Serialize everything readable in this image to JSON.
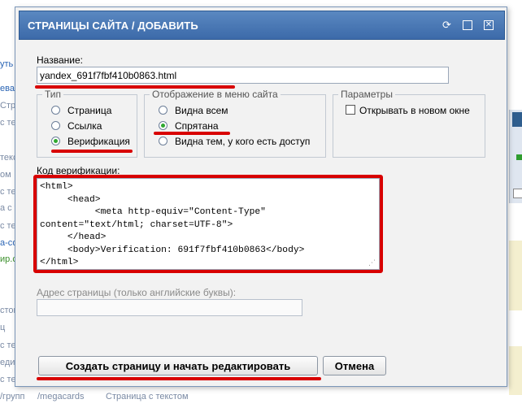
{
  "background": {
    "links": [
      "уть в",
      "ева з",
      "Стра",
      "с текст",
      "текст",
      "ом",
      "с текст",
      "а с тек",
      "с текст",
      "а-соп",
      "ир.со",
      "стом",
      "с текст",
      "ц",
      "едир",
      "с текст"
    ],
    "bottom_path": "/megacards",
    "bottom_text": "Страница с текстом",
    "bottom_left": "/групп"
  },
  "dialog": {
    "title": "СТРАНИЦЫ САЙТА / ДОБАВИТЬ",
    "title_icons": [
      "refresh-icon",
      "maximize-icon",
      "close-icon"
    ],
    "close_glyph": "✕",
    "name_label": "Название:",
    "name_value": "yandex_691f7fbf410b0863.html",
    "type": {
      "legend": "Тип",
      "options": [
        "Страница",
        "Ссылка",
        "Верификация"
      ],
      "selected": "Верификация"
    },
    "menu_display": {
      "legend": "Отображение в меню сайта",
      "options": [
        "Видна всем",
        "Спрятана",
        "Видна тем, у кого есть доступ"
      ],
      "selected": "Спрятана"
    },
    "params": {
      "legend": "Параметры",
      "open_new_window_label": "Открывать в новом окне",
      "open_new_window_checked": false
    },
    "code_label": "Код верификации:",
    "code_value": "<html>\n     <head>\n          <meta http-equiv=\"Content-Type\"\ncontent=\"text/html; charset=UTF-8\">\n     </head>\n     <body>Verification: 691f7fbf410b0863</body>\n</html>",
    "address_label": "Адрес страницы (только английские буквы):",
    "address_value": "",
    "create_button": "Создать страницу и начать редактировать",
    "cancel_button": "Отмена"
  },
  "annotation_color": "#d80000",
  "accent_color": "#3c6aa9"
}
